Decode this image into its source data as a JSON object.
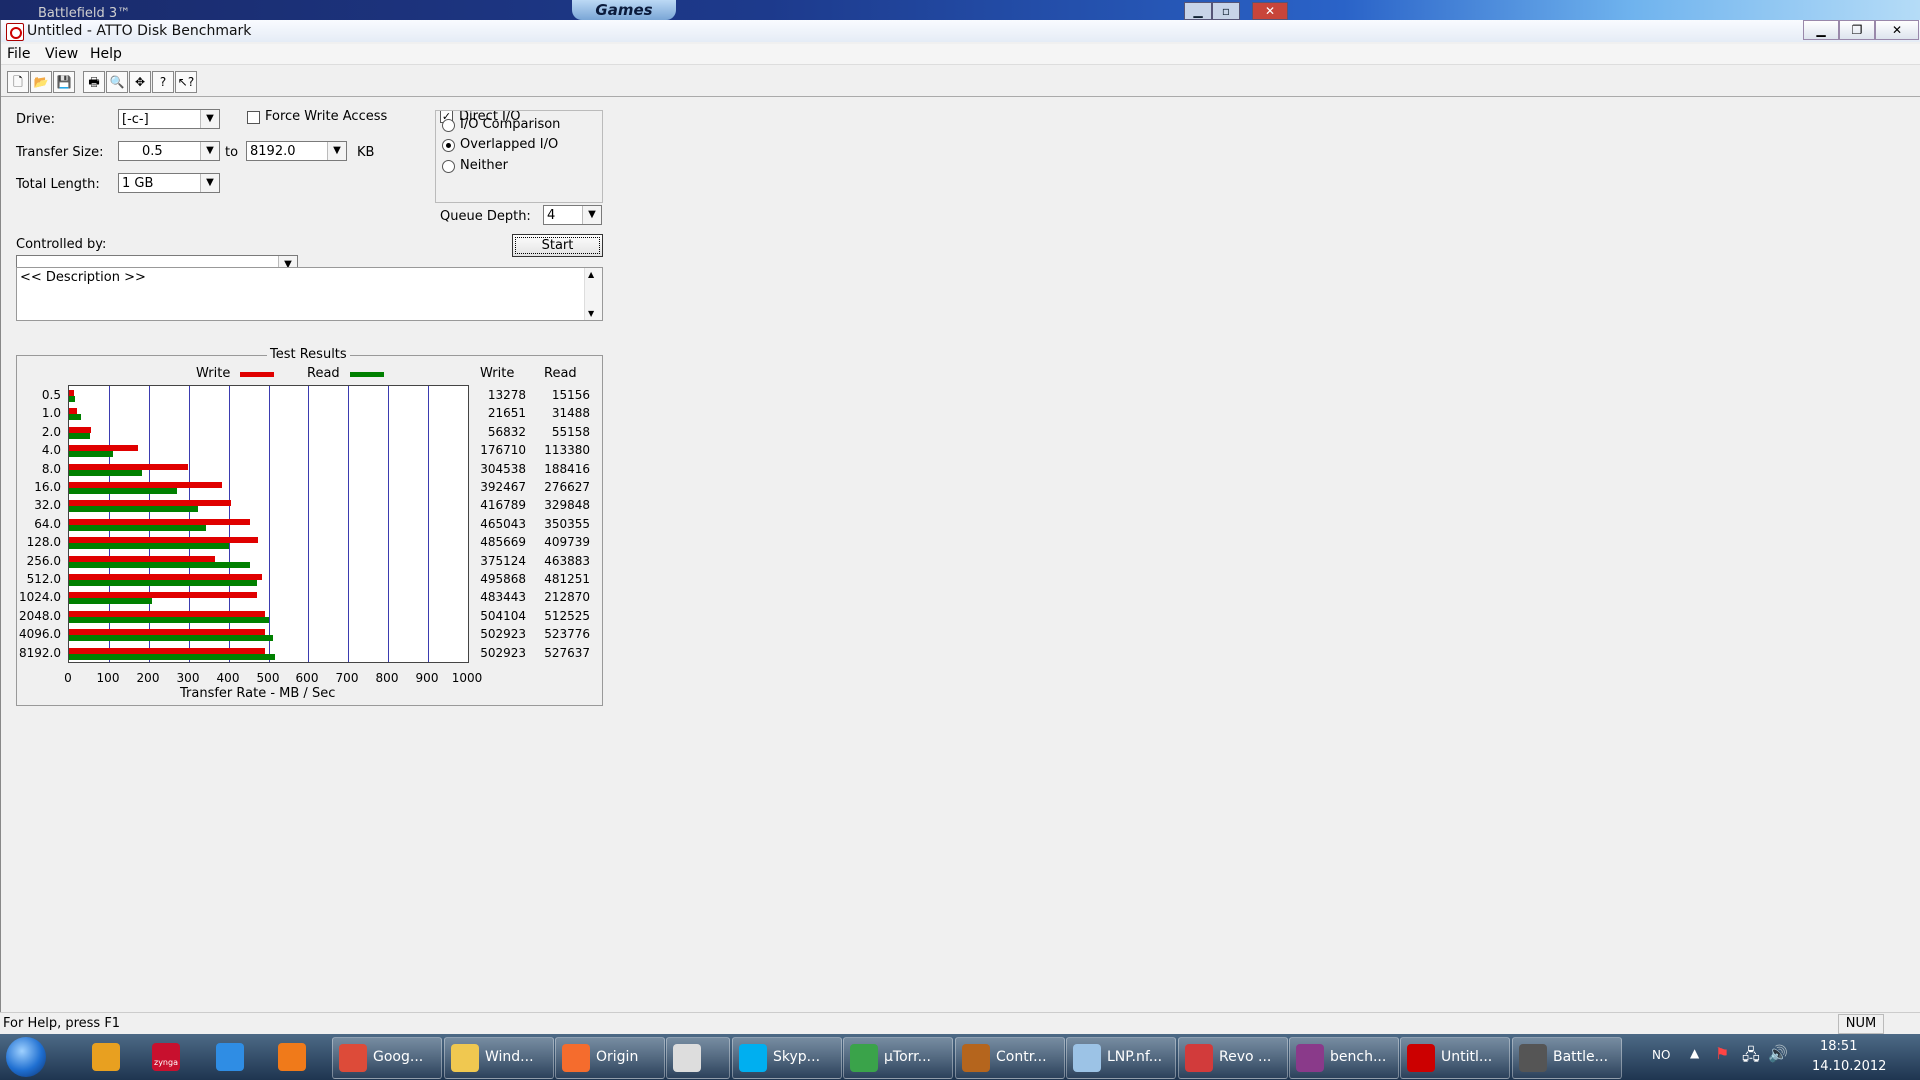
{
  "background": {
    "window_title": "Battlefield 3™",
    "games_tab": "Games"
  },
  "window": {
    "title": "Untitled - ATTO Disk Benchmark"
  },
  "menu": {
    "items": [
      "File",
      "View",
      "Help"
    ]
  },
  "toolbar": {
    "icons": [
      "new-icon",
      "open-icon",
      "save-icon",
      "print-icon",
      "print-preview-icon",
      "move-icon",
      "help-icon",
      "context-help-icon"
    ]
  },
  "form": {
    "drive_label": "Drive:",
    "drive_value": "[-c-]",
    "force_write_label": "Force Write Access",
    "direct_io_label": "Direct I/O",
    "direct_io_checked": true,
    "transfer_size_label": "Transfer Size:",
    "transfer_from": "0.5",
    "to_label": "to",
    "transfer_to": "8192.0",
    "kb_label": "KB",
    "total_length_label": "Total Length:",
    "total_length_value": "1 GB",
    "io_options": [
      {
        "label": "I/O Comparison",
        "checked": false
      },
      {
        "label": "Overlapped I/O",
        "checked": true
      },
      {
        "label": "Neither",
        "checked": false
      }
    ],
    "queue_depth_label": "Queue Depth:",
    "queue_depth_value": "4",
    "controlled_by_label": "Controlled by:",
    "controlled_by_value": "",
    "start_label": "Start",
    "description": "<< Description >>"
  },
  "results": {
    "title": "Test Results",
    "write_legend": "Write",
    "read_legend": "Read",
    "write_col": "Write",
    "read_col": "Read",
    "xlabel": "Transfer Rate - MB / Sec"
  },
  "chart_data": {
    "type": "bar",
    "orientation": "horizontal",
    "title": "Test Results",
    "xlabel": "Transfer Rate - MB / Sec",
    "xlim": [
      0,
      1000
    ],
    "xticks": [
      "0",
      "100",
      "200",
      "300",
      "400",
      "500",
      "600",
      "700",
      "800",
      "900",
      "1000"
    ],
    "categories": [
      "0.5",
      "1.0",
      "2.0",
      "4.0",
      "8.0",
      "16.0",
      "32.0",
      "64.0",
      "128.0",
      "256.0",
      "512.0",
      "1024.0",
      "2048.0",
      "4096.0",
      "8192.0"
    ],
    "series": [
      {
        "name": "Write",
        "color": "#e00000",
        "values": [
          13278,
          21651,
          56832,
          176710,
          304538,
          392467,
          416789,
          465043,
          485669,
          375124,
          495868,
          483443,
          504104,
          502923,
          502923
        ]
      },
      {
        "name": "Read",
        "color": "#008000",
        "values": [
          15156,
          31488,
          55158,
          113380,
          188416,
          276627,
          329848,
          350355,
          409739,
          463883,
          481251,
          212870,
          512525,
          523776,
          527637
        ]
      }
    ],
    "grid": true,
    "legend": "top"
  },
  "statusbar": {
    "help_text": "For Help, press F1",
    "num": "NUM"
  },
  "taskbar": {
    "pinned": [
      {
        "name": "tools-icon",
        "color": "#e8a020"
      },
      {
        "name": "zynga-icon",
        "color": "#c8102e",
        "label": "zynga"
      },
      {
        "name": "ie-icon",
        "color": "#2f8de4"
      },
      {
        "name": "media-player-icon",
        "color": "#f07a1a"
      }
    ],
    "tasks": [
      {
        "label": "Goog...",
        "icon": "chrome-icon",
        "color": "#dd4b39"
      },
      {
        "label": "Wind...",
        "icon": "explorer-icon",
        "color": "#f0c850"
      },
      {
        "label": "Origin",
        "icon": "origin-icon",
        "color": "#f56c2d"
      },
      {
        "label": "",
        "icon": "media-classic-icon",
        "color": "#dddddd"
      },
      {
        "label": "Skyp...",
        "icon": "skype-icon",
        "color": "#00aff0"
      },
      {
        "label": "µTorr...",
        "icon": "utorrent-icon",
        "color": "#3aa34a"
      },
      {
        "label": "Contr...",
        "icon": "control-panel-icon",
        "color": "#b5651d"
      },
      {
        "label": "LNP.nf...",
        "icon": "document-icon",
        "color": "#9cc3e6"
      },
      {
        "label": "Revo ...",
        "icon": "revo-icon",
        "color": "#d23b3b"
      },
      {
        "label": "bench...",
        "icon": "winrar-icon",
        "color": "#8a3a8a"
      },
      {
        "label": "Untitl...",
        "icon": "atto-icon",
        "color": "#cc0000"
      },
      {
        "label": "Battle...",
        "icon": "battlefield-icon",
        "color": "#555555"
      }
    ],
    "tray_lang": "NO",
    "time": "18:51",
    "date": "14.10.2012"
  }
}
